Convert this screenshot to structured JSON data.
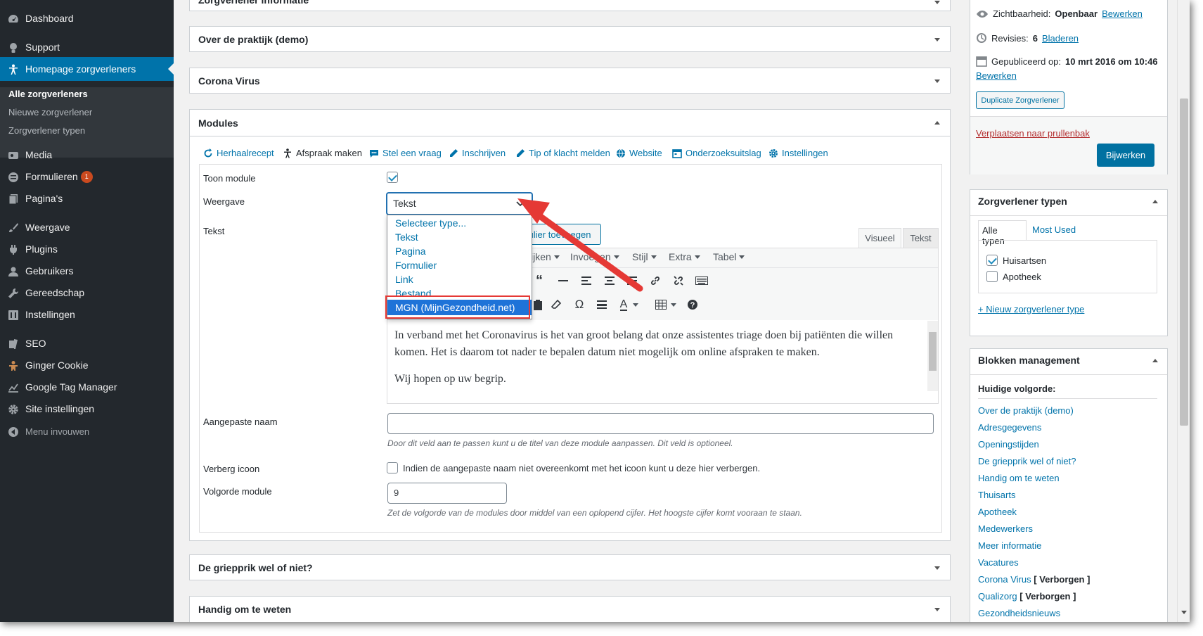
{
  "sidebar": {
    "items": [
      {
        "label": "Dashboard",
        "icon": "dashboard-icon"
      },
      {
        "label": "Support",
        "icon": "lightbulb-icon"
      },
      {
        "label": "Homepage zorgverleners",
        "icon": "person-icon"
      },
      {
        "label": "Media",
        "icon": "media-icon"
      },
      {
        "label": "Formulieren",
        "icon": "forms-icon",
        "badge": "1"
      },
      {
        "label": "Pagina's",
        "icon": "pages-icon"
      },
      {
        "label": "Weergave",
        "icon": "brush-icon"
      },
      {
        "label": "Plugins",
        "icon": "plug-icon"
      },
      {
        "label": "Gebruikers",
        "icon": "users-icon"
      },
      {
        "label": "Gereedschap",
        "icon": "wrench-icon"
      },
      {
        "label": "Instellingen",
        "icon": "settings-icon"
      },
      {
        "label": "SEO",
        "icon": "seo-icon"
      },
      {
        "label": "Ginger Cookie",
        "icon": "gingerbread-icon"
      },
      {
        "label": "Google Tag Manager",
        "icon": "chart-icon"
      },
      {
        "label": "Site instellingen",
        "icon": "gear-icon"
      },
      {
        "label": "Menu invouwen",
        "icon": "collapse-icon"
      }
    ],
    "submenu": [
      "Alle zorgverleners",
      "Nieuwe zorgverlener",
      "Zorgverlener typen"
    ]
  },
  "panels": {
    "p0": "Zorgverlener informatie",
    "p1": "Over de praktijk (demo)",
    "p2": "Corona Virus",
    "p3": "Modules",
    "p4": "De griepprik wel of niet?",
    "p5": "Handig om te weten"
  },
  "module_tabs": [
    "Herhaalrecept",
    "Afspraak maken",
    "Stel een vraag",
    "Inschrijven",
    "Tip of klacht melden",
    "Website",
    "Onderzoeksuitslag",
    "Instellingen"
  ],
  "form": {
    "toon_label": "Toon module",
    "weergave_label": "Weergave",
    "weergave_value": "Tekst",
    "tekst_label": "Tekst",
    "add_form_button": "ulier toevoegen",
    "tab_visual": "Visueel",
    "tab_text": "Tekst",
    "toolbar_menus": [
      "ijken",
      "Invoegen",
      "Stijl",
      "Extra",
      "Tabel"
    ],
    "editor_p1": "In verband met het Coronavirus is het van groot belang dat onze assistentes triage doen bij patiënten die willen komen. Het is daarom tot nader te bepalen datum niet mogelijk om online afspraken te maken.",
    "editor_p2": "Wij hopen op uw begrip.",
    "naam_label": "Aangepaste naam",
    "naam_value": "",
    "naam_desc": "Door dit veld aan te passen kunt u de titel van deze module aanpassen. Dit veld is optioneel.",
    "verberg_label": "Verberg icoon",
    "verberg_text": "Indien de aangepaste naam niet overeenkomt met het icoon kunt u deze hier verbergen.",
    "volgorde_label": "Volgorde module",
    "volgorde_value": "9",
    "volgorde_desc": "Zet de volgorde van de modules door middel van een oplopend cijfer. Het hoogste cijfer komt vooraan te staan."
  },
  "dropdown": {
    "options": [
      "Selecteer type...",
      "Tekst",
      "Pagina",
      "Formulier",
      "Link",
      "Bestand",
      "MGN (MijnGezondheid.net)"
    ],
    "highlighted": "MGN (MijnGezondheid.net)"
  },
  "publish": {
    "visibility_label": "Zichtbaarheid:",
    "visibility_value": "Openbaar",
    "edit1": "Bewerken",
    "revisions_label": "Revisies:",
    "revisions_value": "6",
    "browse": "Bladeren",
    "published_label": "Gepubliceerd op:",
    "published_value": "10 mrt 2016 om 10:46",
    "edit2": "Bewerken",
    "duplicate_button": "Duplicate Zorgverlener",
    "trash_link": "Verplaatsen naar prullenbak",
    "update_button": "Bijwerken"
  },
  "types": {
    "title": "Zorgverlener typen",
    "tab_all": "Alle typen",
    "tab_used": "Most Used",
    "items": [
      {
        "label": "Huisartsen",
        "checked": true
      },
      {
        "label": "Apotheek",
        "checked": false
      }
    ],
    "add_link": "+ Nieuw zorgverlener type"
  },
  "blocks": {
    "title": "Blokken management",
    "subtitle": "Huidige volgorde:",
    "order": [
      "Over de praktijk (demo)",
      "Adresgegevens",
      "Openingstijden",
      "De griepprik wel of niet?",
      "Handig om te weten",
      "Thuisarts",
      "Apotheek",
      "Medewerkers",
      "Meer informatie",
      "Vacatures"
    ],
    "hidden": [
      {
        "name": "Corona Virus",
        "tag": "[ Verborgen ]"
      },
      {
        "name": "Qualizorg",
        "tag": "[ Verborgen ]"
      }
    ],
    "last": "Gezondheidsnieuws"
  },
  "colors": {
    "accent": "#0073aa",
    "sidebar": "#23282d",
    "annotation": "#e53935"
  }
}
